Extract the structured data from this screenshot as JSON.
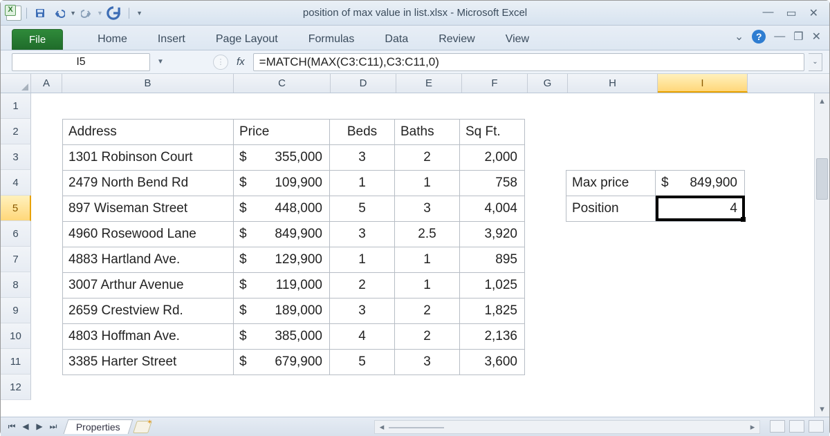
{
  "window": {
    "title": "position of max value in list.xlsx  -  Microsoft Excel"
  },
  "ribbon": {
    "file": "File",
    "tabs": [
      "Home",
      "Insert",
      "Page Layout",
      "Formulas",
      "Data",
      "Review",
      "View"
    ]
  },
  "formula_bar": {
    "name_box": "I5",
    "fx_label": "fx",
    "formula": "=MATCH(MAX(C3:C11),C3:C11,0)"
  },
  "columns": [
    "A",
    "B",
    "C",
    "D",
    "E",
    "F",
    "G",
    "H",
    "I"
  ],
  "rows": [
    "1",
    "2",
    "3",
    "4",
    "5",
    "6",
    "7",
    "8",
    "9",
    "10",
    "11",
    "12"
  ],
  "active_cell": "I5",
  "active_row": "5",
  "active_col": "I",
  "table": {
    "headers": {
      "address": "Address",
      "price": "Price",
      "beds": "Beds",
      "baths": "Baths",
      "sqft": "Sq Ft."
    },
    "rows": [
      {
        "address": "1301 Robinson Court",
        "price": "355,000",
        "beds": "3",
        "baths": "2",
        "sqft": "2,000"
      },
      {
        "address": "2479 North Bend Rd",
        "price": "109,900",
        "beds": "1",
        "baths": "1",
        "sqft": "758"
      },
      {
        "address": "897 Wiseman Street",
        "price": "448,000",
        "beds": "5",
        "baths": "3",
        "sqft": "4,004"
      },
      {
        "address": "4960 Rosewood Lane",
        "price": "849,900",
        "beds": "3",
        "baths": "2.5",
        "sqft": "3,920"
      },
      {
        "address": "4883 Hartland Ave.",
        "price": "129,900",
        "beds": "1",
        "baths": "1",
        "sqft": "895"
      },
      {
        "address": "3007 Arthur Avenue",
        "price": "119,000",
        "beds": "2",
        "baths": "1",
        "sqft": "1,025"
      },
      {
        "address": "2659 Crestview Rd.",
        "price": "189,000",
        "beds": "3",
        "baths": "2",
        "sqft": "1,825"
      },
      {
        "address": "4803 Hoffman Ave.",
        "price": "385,000",
        "beds": "4",
        "baths": "2",
        "sqft": "2,136"
      },
      {
        "address": "3385 Harter Street",
        "price": "679,900",
        "beds": "5",
        "baths": "3",
        "sqft": "3,600"
      }
    ]
  },
  "summary": {
    "max_label": "Max price",
    "max_value": "849,900",
    "pos_label": "Position",
    "pos_value": "4"
  },
  "sheet_tabs": {
    "active": "Properties"
  },
  "currency": "$"
}
